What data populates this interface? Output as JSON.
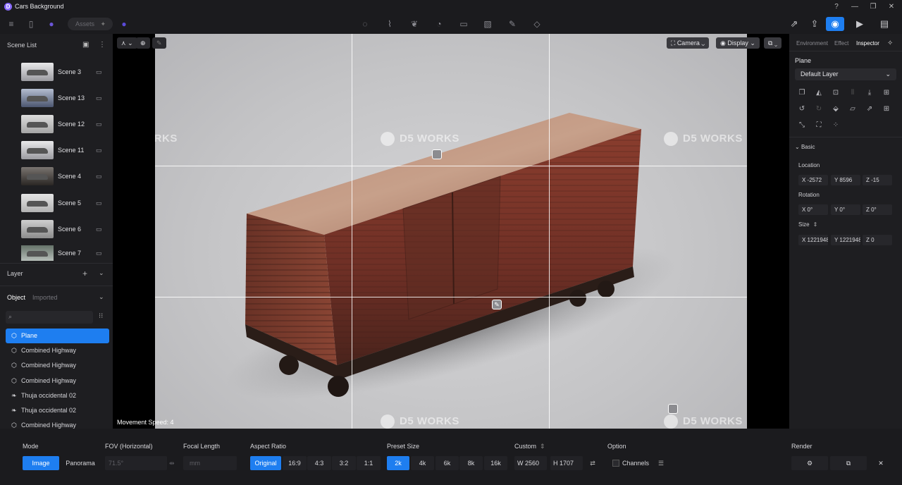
{
  "app": {
    "title": "Cars Background",
    "logo": "D"
  },
  "toolbar": {
    "assets_label": "Assets"
  },
  "scene_list": {
    "title": "Scene List",
    "scenes": [
      {
        "label": "Scene 3"
      },
      {
        "label": "Scene 13"
      },
      {
        "label": "Scene 12"
      },
      {
        "label": "Scene 11"
      },
      {
        "label": "Scene 4"
      },
      {
        "label": "Scene 5"
      },
      {
        "label": "Scene 6"
      },
      {
        "label": "Scene 7"
      }
    ]
  },
  "layer": {
    "title": "Layer",
    "tabs": [
      "Object",
      "Imported"
    ],
    "items": [
      {
        "label": "Plane"
      },
      {
        "label": "Combined Highway"
      },
      {
        "label": "Combined Highway"
      },
      {
        "label": "Combined Highway"
      },
      {
        "label": "Thuja occidental 02"
      },
      {
        "label": "Thuja occidental 02"
      },
      {
        "label": "Combined Highway"
      }
    ]
  },
  "viewport": {
    "camera_label": "Camera",
    "display_label": "Display",
    "watermark": "D5 WORKS",
    "movement_label": "Movement Speed: 4"
  },
  "inspector": {
    "tabs": [
      "Environment",
      "Effect",
      "Inspector"
    ],
    "title": "Plane",
    "layer_select": "Default Layer",
    "basic_label": "Basic",
    "location_label": "Location",
    "location": {
      "x": "X -2572",
      "y": "Y 8596",
      "z": "Z -15"
    },
    "rotation_label": "Rotation",
    "rotation": {
      "x": "X 0°",
      "y": "Y 0°",
      "z": "Z 0°"
    },
    "size_label": "Size",
    "size": {
      "x": "X 1221948",
      "y": "Y 1221948",
      "z": "Z 0"
    }
  },
  "bottom": {
    "mode_label": "Mode",
    "mode_image": "Image",
    "mode_panorama": "Panorama",
    "fov_label": "FOV (Horizontal)",
    "fov_value": "71.5°",
    "focal_label": "Focal Length",
    "focal_value": "mm",
    "aspect_label": "Aspect Ratio",
    "aspect_options": [
      "Original",
      "16:9",
      "4:3",
      "3:2",
      "1:1"
    ],
    "preset_label": "Preset Size",
    "preset_options": [
      "2k",
      "4k",
      "6k",
      "8k",
      "16k"
    ],
    "custom_label": "Custom",
    "width": "W  2560",
    "height": "H  1707",
    "option_label": "Option",
    "channels_label": "Channels",
    "render_label": "Render"
  },
  "colors": {
    "accent": "#1e7ef0",
    "background": "#1b1b1e",
    "boxcar_rust": "#7a3326"
  }
}
